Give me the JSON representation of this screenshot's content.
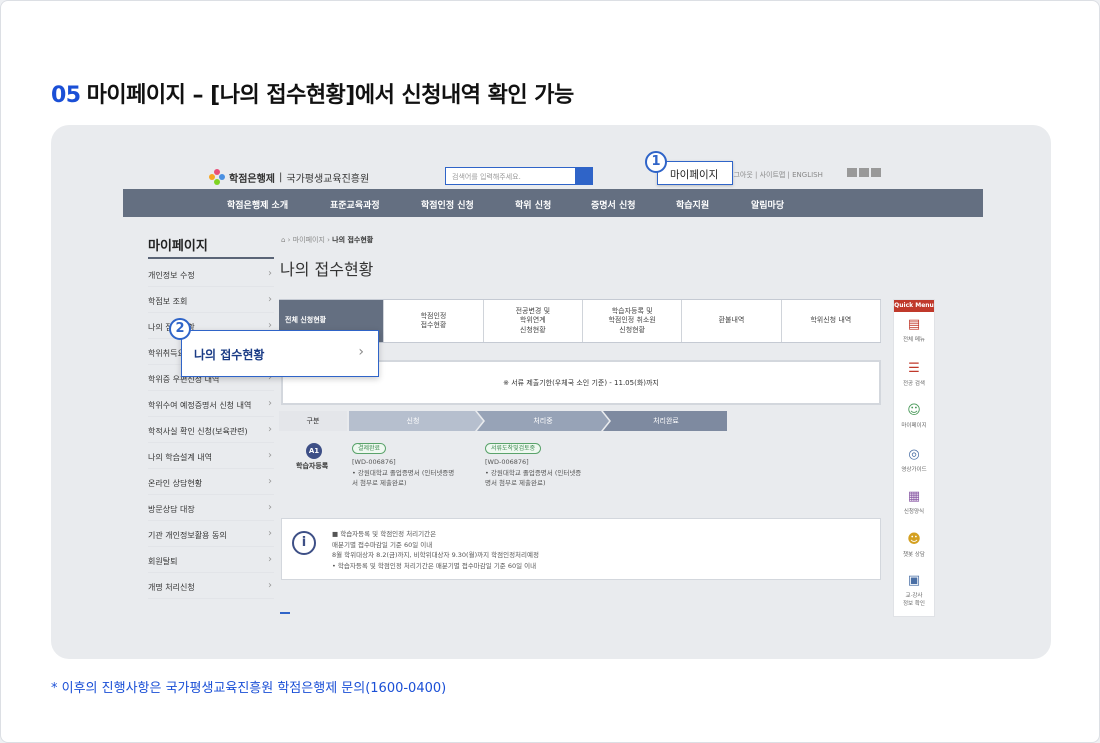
{
  "heading": {
    "number": "05",
    "text": "마이페이지 – [나의 접수현황]에서 신청내역 확인 가능"
  },
  "site": {
    "logo": {
      "name": "학점은행제",
      "org": "국가평생교육진흥원"
    },
    "search": {
      "placeholder": "검색어를 입력해주세요."
    },
    "utility": {
      "items": "로그아웃 | 사이트맵 | ENGLISH"
    },
    "callout_mypage": {
      "badge": "1",
      "label": "마이페이지"
    },
    "nav": [
      "학점은행제 소개",
      "표준교육과정",
      "학점인정 신청",
      "학위 신청",
      "증명서 신청",
      "학습지원",
      "알림마당"
    ],
    "sidebar": {
      "title": "마이페이지",
      "items": [
        "개인정보 수정",
        "학점보 조회",
        "나의 접수현황",
        "학위취득요건 모의계산",
        "학위증 우편신청 내역",
        "학위수여 예정증명서 신청 내역",
        "학적사실 확인 신청(보육관련)",
        "나의 학습설계 내역",
        "온라인 상담현황",
        "방문상담 대장",
        "기관 개인정보활용 동의",
        "회원탈퇴",
        "개명 처리신청"
      ]
    },
    "callout_status": {
      "badge": "2",
      "label": "나의 접수현황"
    },
    "breadcrumb": {
      "home": "⌂",
      "parent": "마이페이지",
      "current": "나의 접수현황"
    },
    "page_title": "나의 접수현황",
    "tabs": [
      "전체 신청현황",
      "학점인정\n접수현황",
      "전공변경 및\n학위연계\n신청현황",
      "학습자등록 및\n학점인정 취소원\n신청현황",
      "환불내역",
      "학위신청 내역"
    ],
    "notice": "※ 서류 제출기한(우체국 소인 기준) - 11.05(화)까지",
    "steps": {
      "gubun": "구분",
      "labels": [
        "신청",
        "처리중",
        "처리완료"
      ]
    },
    "row": {
      "badge": "A1",
      "label": "학습자등록",
      "col1": {
        "pill": "결제완료",
        "id": "[WD-006876]",
        "doc1": "• 강원대학교 졸업증명서 (인터넷증명",
        "doc2": "  서 첨부로 제출완료)"
      },
      "col2": {
        "pill": "서류도착및검토중",
        "id": "[WD-006876]",
        "doc1": "• 강원대학교 졸업증명서 (인터넷증",
        "doc2": "  명서 첨부로 제출완료)"
      }
    },
    "info": {
      "icon": "i",
      "line1": "■ 학습자등록 및 학점인정 처리기간은",
      "line2": "매분기별 접수마감일 기준 60일 이내",
      "line3": "8월 학위대상자 8.2(금)까지, 비학위대상자 9.30(월)까지 학점인정처리예정",
      "line4": "• 학습자등록 및 학점인정 처리기간은 매분기별 접수마감일 기준 60일 이내"
    },
    "quick_menu": {
      "title": "Quick Menu",
      "items": [
        "전체 메뉴",
        "전공 검색",
        "마이페이지",
        "영상가이드",
        "신청양식",
        "챗봇 상담",
        "교·강사\n정보 확인"
      ]
    },
    "colors": {
      "nav": "#646f81",
      "accent": "#2f64c8",
      "quick": "#c0392b"
    }
  },
  "footnote": "* 이후의 진행사항은 국가평생교육진흥원 학점은행제 문의(1600-0400)"
}
